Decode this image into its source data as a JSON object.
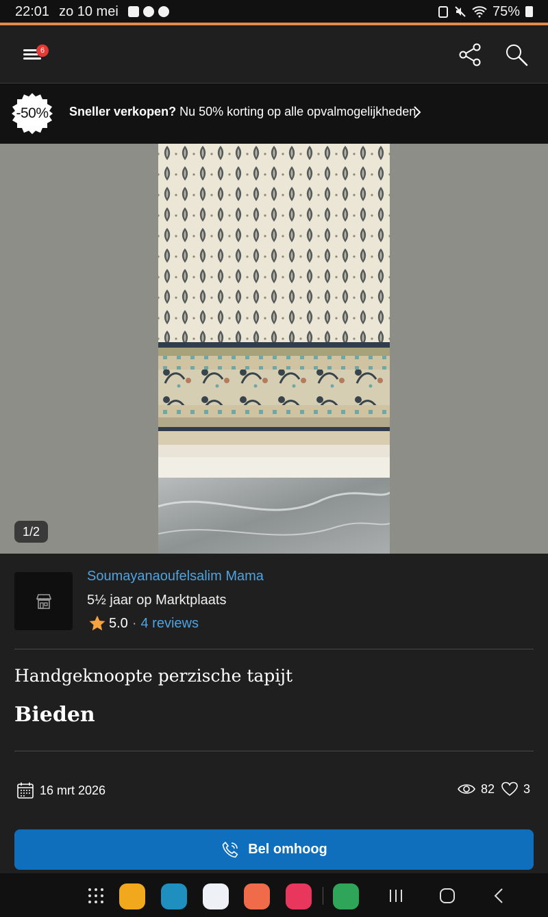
{
  "status_bar": {
    "time": "22:01",
    "date": "zo 10 mei",
    "battery": "75%"
  },
  "header": {
    "menu_badge": "6",
    "share_icon": "share-icon",
    "search_icon": "search-icon"
  },
  "promo": {
    "badge": "-50%",
    "bold_text": "Sneller verkopen?",
    "text": " Nu 50% korting op alle opvalmogelijkheden"
  },
  "gallery": {
    "counter": "1/2"
  },
  "seller": {
    "name": "Soumayanaoufelsalim Mama",
    "since": "5½ jaar op Marktplaats",
    "rating": "5.0",
    "separator": "·",
    "reviews": "4 reviews"
  },
  "listing": {
    "title": "Handgeknoopte perzische tapijt",
    "price": "Bieden",
    "date": "16 mrt 2026",
    "views": "82",
    "favorites": "3"
  },
  "actions": {
    "call_label": "Bel omhoog"
  },
  "colors": {
    "accent": "#e2894b",
    "link": "#4fa3e0",
    "call_button": "#0f6fbd",
    "badge": "#e53935"
  }
}
